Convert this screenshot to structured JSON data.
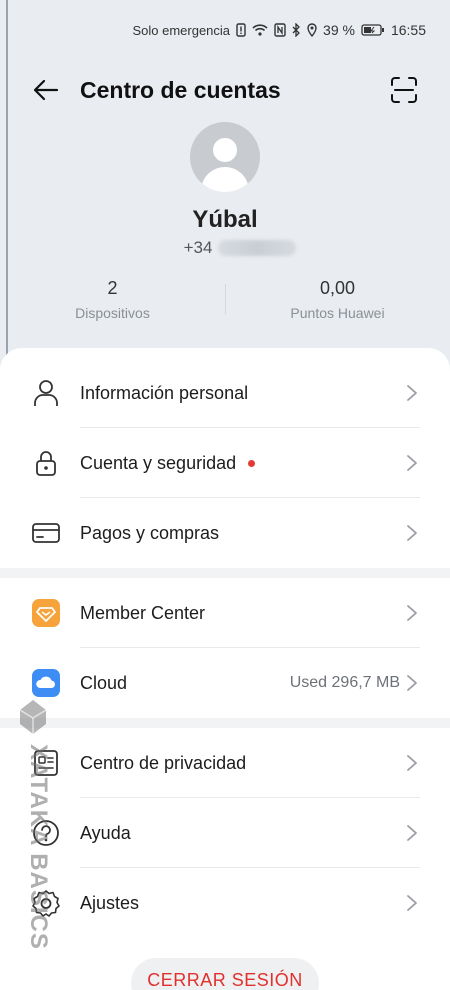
{
  "status_bar": {
    "network_text": "Solo emergencia",
    "battery_percent": "39 %",
    "time": "16:55"
  },
  "header": {
    "title": "Centro de cuentas"
  },
  "profile": {
    "name": "Yúbal",
    "phone_prefix": "+34"
  },
  "stats": [
    {
      "value": "2",
      "label": "Dispositivos"
    },
    {
      "value": "0,00",
      "label": "Puntos Huawei"
    }
  ],
  "menu": {
    "personal_info": "Información personal",
    "security": "Cuenta y seguridad",
    "payments": "Pagos y compras",
    "member_center": "Member Center",
    "cloud": "Cloud",
    "cloud_value": "Used 296,7 MB",
    "privacy": "Centro de privacidad",
    "help": "Ayuda",
    "settings": "Ajustes"
  },
  "logout_label": "CERRAR SESIÓN",
  "watermark": "XATAKA BASICS",
  "colors": {
    "background": "#e9edf1",
    "accent_red": "#e0312d",
    "member_center_icon": "#f6a33b",
    "cloud_icon": "#3d8df5"
  }
}
